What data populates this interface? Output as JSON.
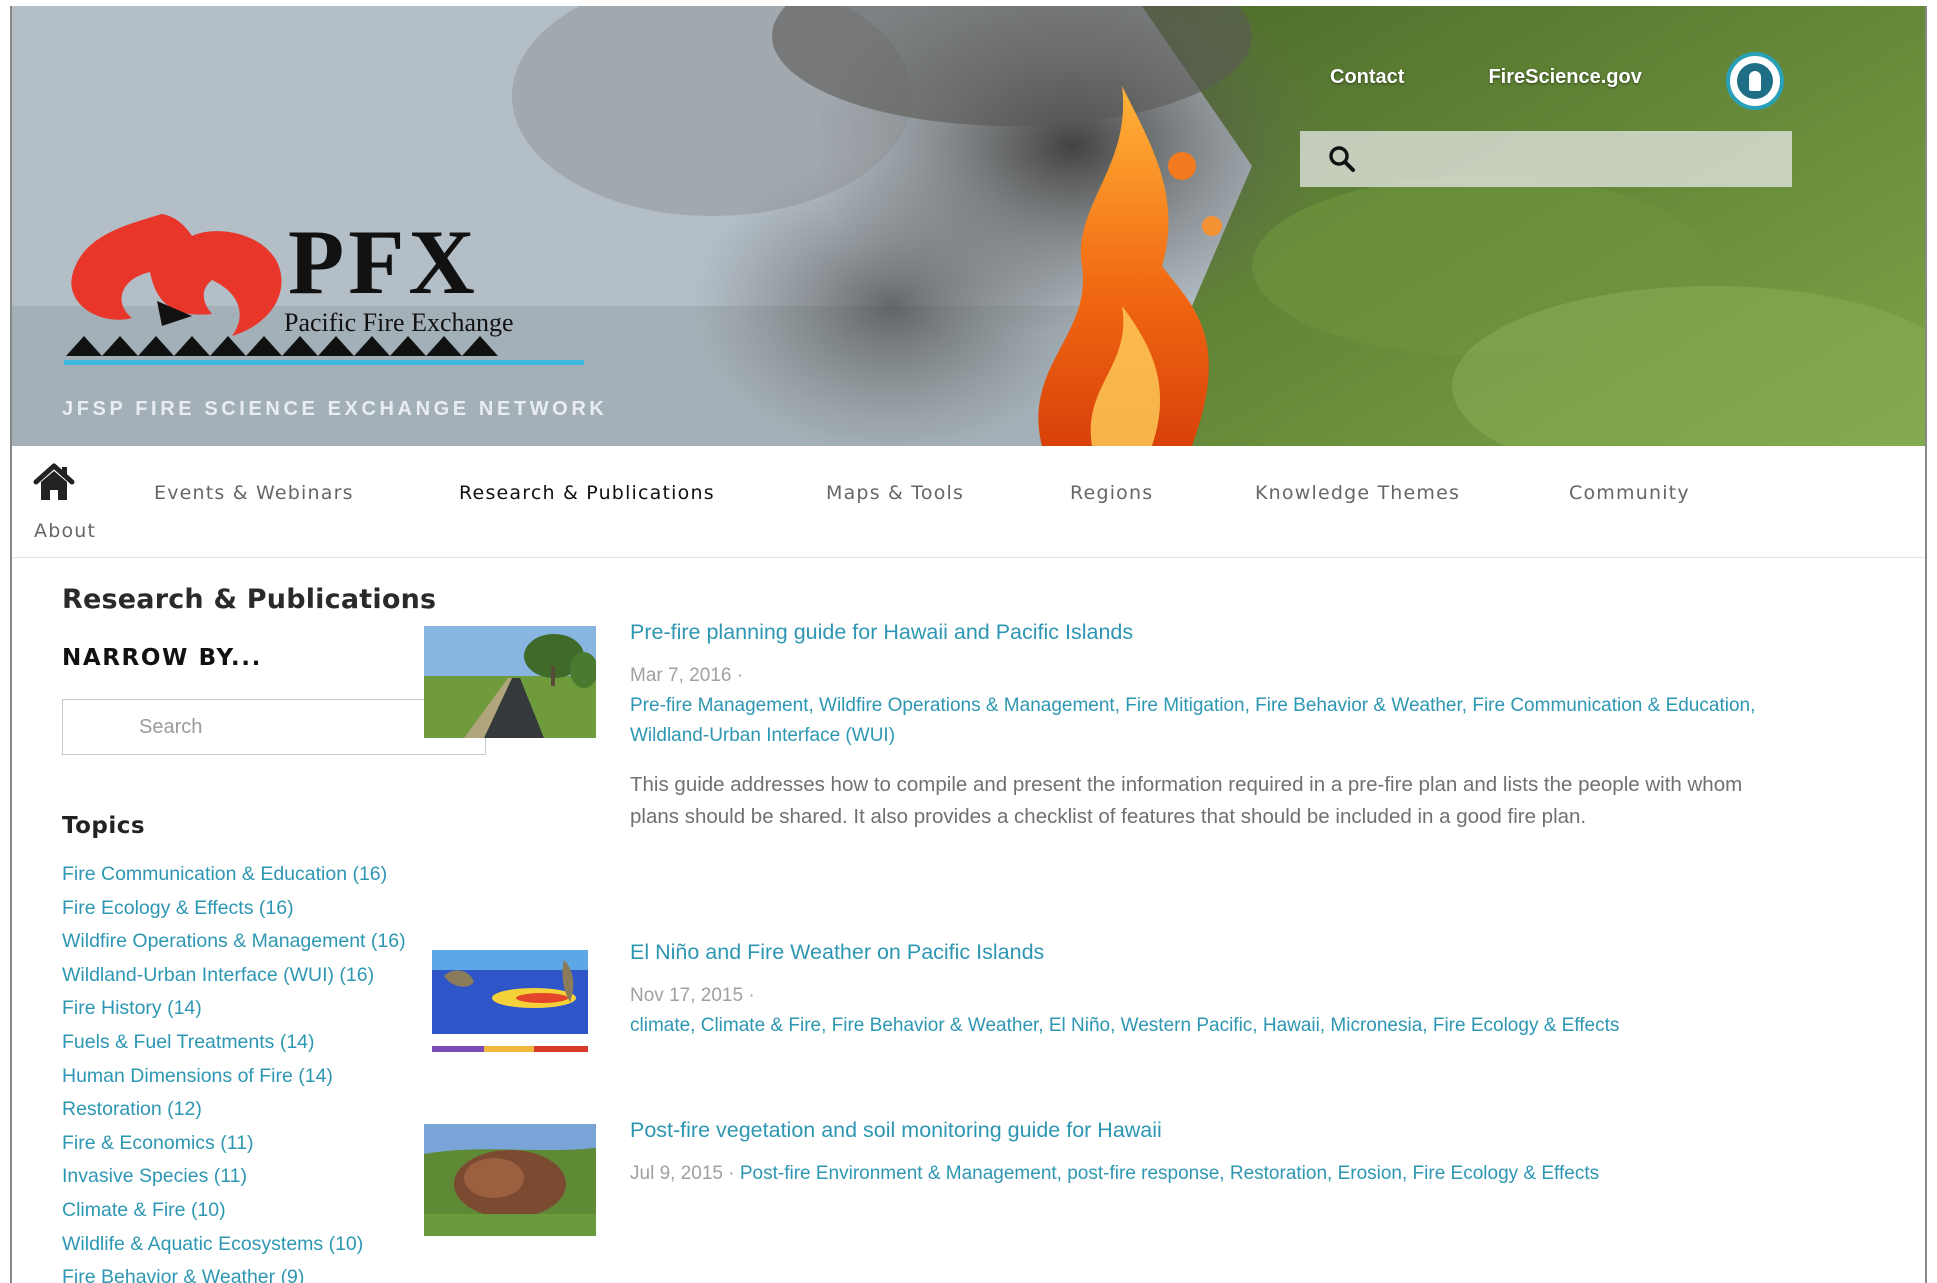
{
  "header": {
    "links": [
      "Contact",
      "FireScience.gov"
    ],
    "search_placeholder": "",
    "logo_title": "PFX",
    "logo_subtitle": "Pacific Fire Exchange",
    "network": "JFSP FIRE SCIENCE EXCHANGE NETWORK"
  },
  "nav": {
    "items": [
      "Events & Webinars",
      "Research & Publications",
      "Maps & Tools",
      "Regions",
      "Knowledge Themes",
      "Community"
    ],
    "about": "About",
    "active": "Research & Publications"
  },
  "sidebar": {
    "title": "Research & Publications",
    "narrow": "NARROW BY...",
    "search_placeholder": "Search",
    "topics_heading": "Topics",
    "topics": [
      "Fire Communication & Education (16)",
      "Fire Ecology & Effects (16)",
      "Wildfire Operations & Management (16)",
      "Wildland-Urban Interface (WUI) (16)",
      "Fire History (14)",
      "Fuels & Fuel Treatments (14)",
      "Human Dimensions of Fire (14)",
      "Restoration (12)",
      "Fire & Economics (11)",
      "Invasive Species (11)",
      "Climate & Fire (10)",
      "Wildlife & Aquatic Ecosystems (10)",
      "Fire Behavior & Weather (9)"
    ]
  },
  "results": [
    {
      "title": "Pre-fire planning guide for Hawaii and Pacific Islands",
      "date": "Mar 7, 2016",
      "tags": "Pre-fire Management, Wildfire Operations & Management, Fire Mitigation, Fire Behavior & Weather, Fire Communication & Education, Wildland-Urban Interface (WUI)",
      "description": "This guide addresses how to compile and present the information required in a pre-fire plan and lists the people with whom plans should be shared.  It also provides a checklist of features that should be included in a good fire plan."
    },
    {
      "title": "El Niño and Fire Weather on Pacific Islands",
      "date": "Nov 17, 2015",
      "tags": "climate, Climate & Fire, Fire Behavior & Weather, El Niño, Western Pacific, Hawaii, Micronesia, Fire Ecology & Effects",
      "description": ""
    },
    {
      "title": "Post-fire vegetation and soil monitoring guide for Hawaii",
      "date": "Jul 9, 2015",
      "tags": "Post-fire Environment & Management, post-fire response, Restoration, Erosion, Fire Ecology & Effects",
      "description": ""
    }
  ],
  "meta_separator": "·",
  "colors": {
    "link": "#2d97b3",
    "muted": "#a0a0a0",
    "logo_red": "#e8372a"
  }
}
